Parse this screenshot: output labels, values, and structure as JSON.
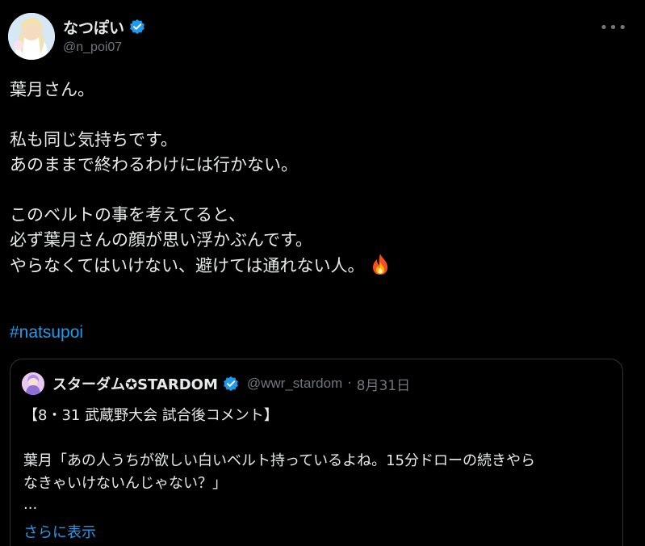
{
  "author": {
    "display_name": "なつぽい",
    "handle": "@n_poi07",
    "avatar_icon": "user-avatar",
    "verified_icon": "verified-badge-icon",
    "more_icon": "more-options-icon"
  },
  "tweet": {
    "lines": [
      "葉月さん。",
      "",
      "私も同じ気持ちです。",
      "あのままで終わるわけには行かない。",
      "",
      "このベルトの事を考えてると、",
      "必ず葉月さんの顔が思い浮かぶんです。",
      "やらなくてはいけない、避けては通れない人。"
    ],
    "emoji_icon": "fire-icon",
    "hashtag": "#natsupoi"
  },
  "quote": {
    "display_name": "スターダム✪STARDOM",
    "handle": "@wwr_stardom",
    "separator": "·",
    "date": "8月31日",
    "lines": [
      "【8・31 武蔵野大会 試合後コメント】",
      "",
      "葉月「あの人うちが欲しい白いベルト持っているよね。15分ドローの続きやら",
      "なきゃいけないんじゃない？」"
    ],
    "ellipsis": "...",
    "show_more": "さらに表示"
  },
  "colors": {
    "background": "#000000",
    "text": "#e7e9ea",
    "secondary": "#71767b",
    "accent": "#1d9bf0",
    "border": "#2f3336"
  }
}
